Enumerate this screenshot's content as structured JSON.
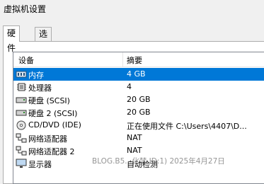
{
  "window": {
    "title": "虚拟机设置"
  },
  "tabs": [
    {
      "label": "硬件"
    },
    {
      "label": "选项"
    }
  ],
  "table": {
    "columns": [
      "设备",
      "摘要"
    ],
    "rows": [
      {
        "device": "内存",
        "summary": "4 GB",
        "icon": "memory-icon"
      },
      {
        "device": "处理器",
        "summary": "4",
        "icon": "processor-icon"
      },
      {
        "device": "硬盘 (SCSI)",
        "summary": "20 GB",
        "icon": "hard-disk-icon"
      },
      {
        "device": "硬盘 2 (SCSI)",
        "summary": "20 GB",
        "icon": "hard-disk-icon"
      },
      {
        "device": "CD/DVD (IDE)",
        "summary": "正在使用文件 C:\\Users\\4407\\D...",
        "icon": "cd-dvd-icon"
      },
      {
        "device": "网络适配器",
        "summary": "NAT",
        "icon": "network-adapter-icon"
      },
      {
        "device": "网络适配器 2",
        "summary": "NAT",
        "icon": "network-adapter-icon"
      },
      {
        "device": "显示器",
        "summary": "自动检测",
        "icon": "display-icon"
      }
    ]
  },
  "watermark": "BLOG.B5...化梦 ID:1) 2025年4月27日"
}
